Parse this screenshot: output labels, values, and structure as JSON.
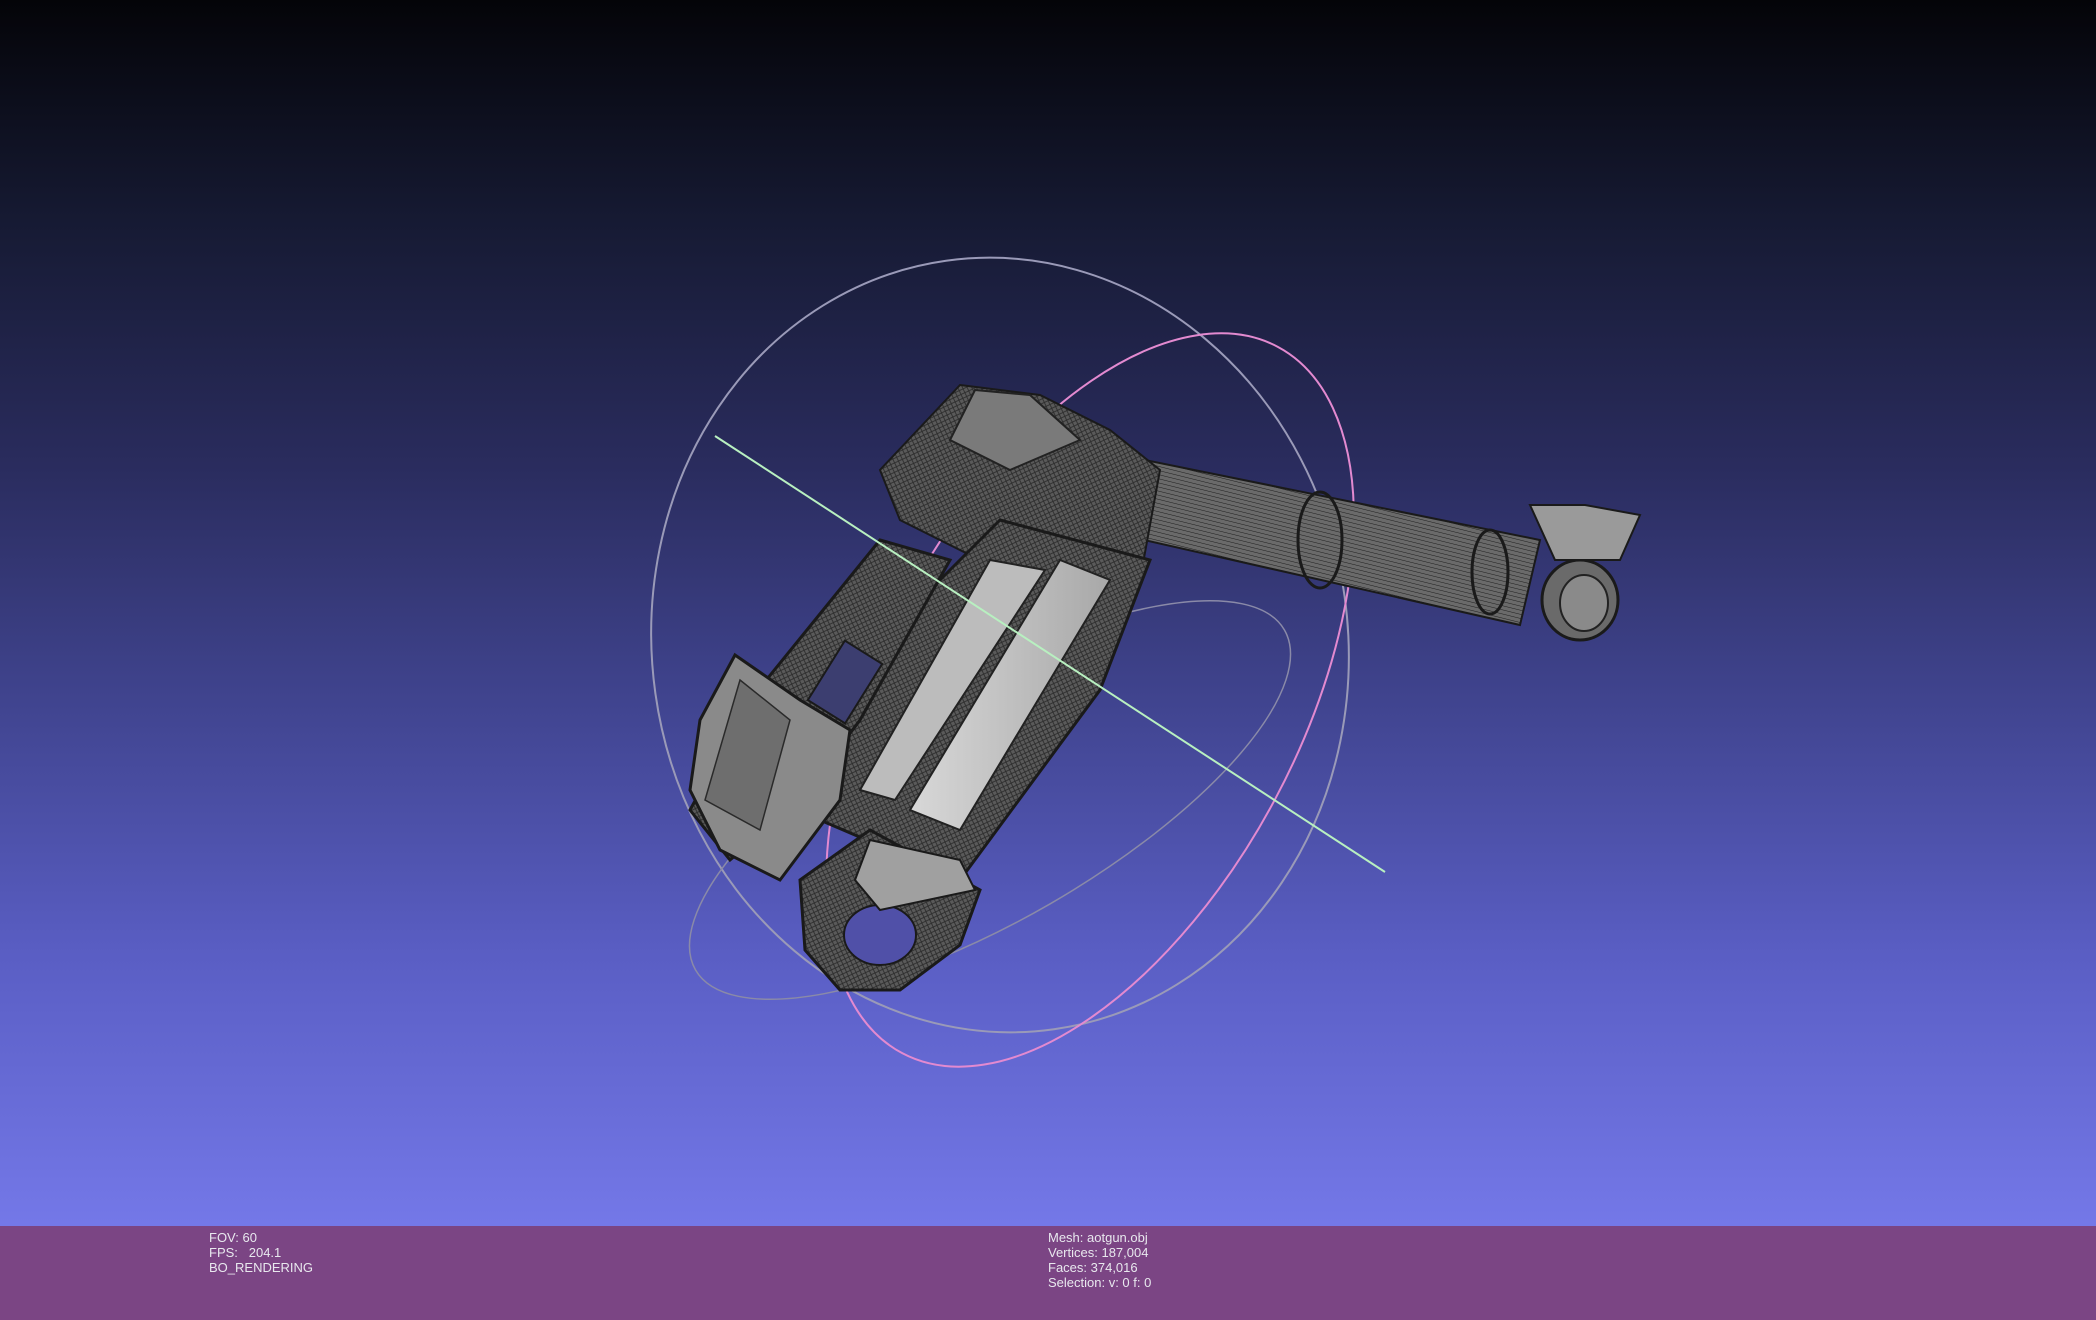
{
  "viewport": {
    "model": "gun-wireframe-mesh",
    "background_top_color": "#040408",
    "background_bottom_color": "#7478e8",
    "trackball_colors": {
      "ring_gray": "#9a9ab8",
      "ring_pink": "#e38ad0",
      "axis_green": "#b8f0c0"
    }
  },
  "status": {
    "fov": "FOV: 60",
    "fps": "FPS:   204.1",
    "mode": "BO_RENDERING",
    "mesh": "Mesh: aotgun.obj",
    "vertices": "Vertices: 187,004",
    "faces": "Faces: 374,016",
    "selection": "Selection: v: 0 f: 0"
  },
  "colors": {
    "status_bar_bg": "#7b4584",
    "status_text": "#e8e8ee"
  }
}
